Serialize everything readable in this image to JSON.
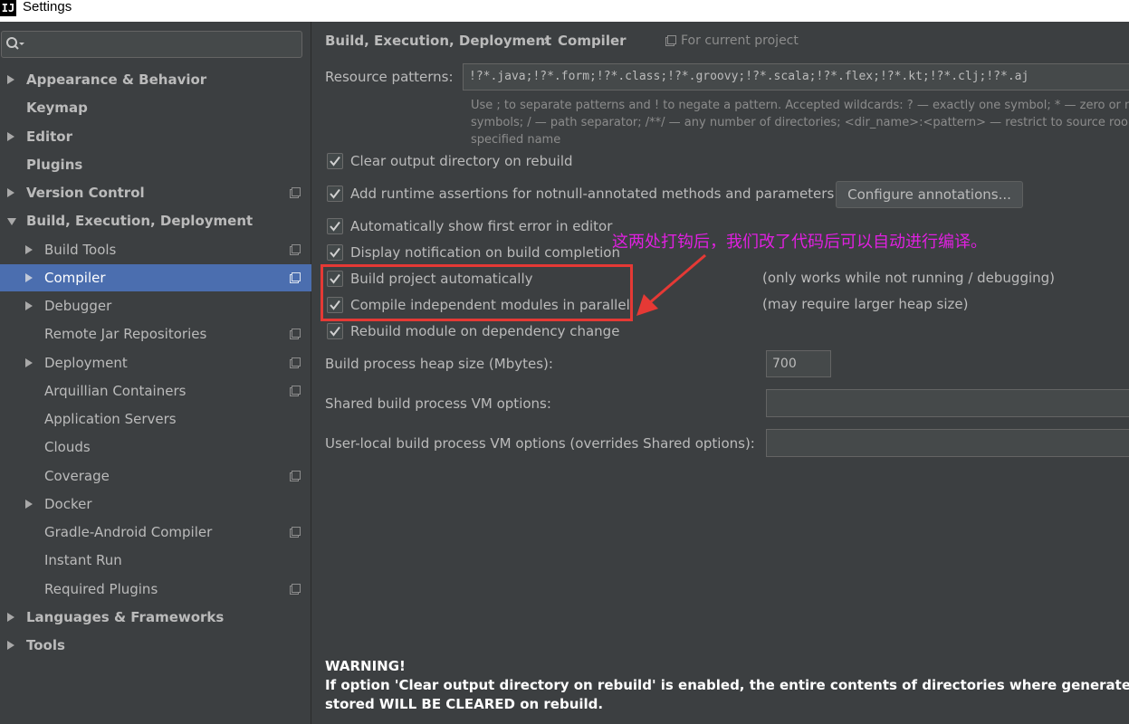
{
  "window": {
    "title": "Settings",
    "icon_glyph": "IJ"
  },
  "search": {
    "placeholder": ""
  },
  "sidebar": {
    "items": [
      {
        "label": "Appearance & Behavior",
        "level": 0,
        "arrow": "right",
        "bold": true,
        "project_icon": false,
        "selected": false
      },
      {
        "label": "Keymap",
        "level": 0,
        "arrow": "none",
        "bold": true,
        "project_icon": false,
        "selected": false
      },
      {
        "label": "Editor",
        "level": 0,
        "arrow": "right",
        "bold": true,
        "project_icon": false,
        "selected": false
      },
      {
        "label": "Plugins",
        "level": 0,
        "arrow": "none",
        "bold": true,
        "project_icon": false,
        "selected": false
      },
      {
        "label": "Version Control",
        "level": 0,
        "arrow": "right",
        "bold": true,
        "project_icon": true,
        "selected": false
      },
      {
        "label": "Build, Execution, Deployment",
        "level": 0,
        "arrow": "down",
        "bold": true,
        "project_icon": false,
        "selected": false
      },
      {
        "label": "Build Tools",
        "level": 1,
        "arrow": "right",
        "bold": false,
        "project_icon": true,
        "selected": false
      },
      {
        "label": "Compiler",
        "level": 1,
        "arrow": "right",
        "bold": false,
        "project_icon": true,
        "selected": true
      },
      {
        "label": "Debugger",
        "level": 1,
        "arrow": "right",
        "bold": false,
        "project_icon": false,
        "selected": false
      },
      {
        "label": "Remote Jar Repositories",
        "level": 1,
        "arrow": "none",
        "bold": false,
        "project_icon": true,
        "selected": false
      },
      {
        "label": "Deployment",
        "level": 1,
        "arrow": "right",
        "bold": false,
        "project_icon": true,
        "selected": false
      },
      {
        "label": "Arquillian Containers",
        "level": 1,
        "arrow": "none",
        "bold": false,
        "project_icon": true,
        "selected": false
      },
      {
        "label": "Application Servers",
        "level": 1,
        "arrow": "none",
        "bold": false,
        "project_icon": false,
        "selected": false
      },
      {
        "label": "Clouds",
        "level": 1,
        "arrow": "none",
        "bold": false,
        "project_icon": false,
        "selected": false
      },
      {
        "label": "Coverage",
        "level": 1,
        "arrow": "none",
        "bold": false,
        "project_icon": true,
        "selected": false
      },
      {
        "label": "Docker",
        "level": 1,
        "arrow": "right",
        "bold": false,
        "project_icon": false,
        "selected": false
      },
      {
        "label": "Gradle-Android Compiler",
        "level": 1,
        "arrow": "none",
        "bold": false,
        "project_icon": true,
        "selected": false
      },
      {
        "label": "Instant Run",
        "level": 1,
        "arrow": "none",
        "bold": false,
        "project_icon": false,
        "selected": false
      },
      {
        "label": "Required Plugins",
        "level": 1,
        "arrow": "none",
        "bold": false,
        "project_icon": true,
        "selected": false
      },
      {
        "label": "Languages & Frameworks",
        "level": 0,
        "arrow": "right",
        "bold": true,
        "project_icon": false,
        "selected": false
      },
      {
        "label": "Tools",
        "level": 0,
        "arrow": "right",
        "bold": true,
        "project_icon": false,
        "selected": false
      }
    ]
  },
  "header": {
    "crumb_1": "Build, Execution, Deployment",
    "separator": "›",
    "crumb_2": "Compiler",
    "scope": "For current project"
  },
  "resource_patterns": {
    "label": "Resource patterns:",
    "value": "!?*.java;!?*.form;!?*.class;!?*.groovy;!?*.scala;!?*.flex;!?*.kt;!?*.clj;!?*.aj",
    "help_1": "Use ; to separate patterns and ! to negate a pattern. Accepted wildcards: ? — exactly one symbol; * — zero or m",
    "help_2": "symbols; / — path separator; /**/ — any number of directories; <dir_name>:<pattern> — restrict to source roo",
    "help_3": "specified name"
  },
  "options": {
    "clear_output": {
      "label": "Clear output directory on rebuild",
      "checked": true
    },
    "runtime_assertions": {
      "label": "Add runtime assertions for notnull-annotated methods and parameters",
      "checked": true
    },
    "show_first_error": {
      "label": "Automatically show first error in editor",
      "checked": true
    },
    "display_notification": {
      "label": "Display notification on build completion",
      "checked": true
    },
    "build_automatically": {
      "label": "Build project automatically",
      "checked": true,
      "note": "(only works while not running / debugging)"
    },
    "compile_parallel": {
      "label": "Compile independent modules in parallel",
      "checked": true,
      "note": "(may require larger heap size)"
    },
    "rebuild_on_dependency": {
      "label": "Rebuild module on dependency change",
      "checked": true
    }
  },
  "configure_button": "Configure annotations...",
  "heap_size": {
    "label": "Build process heap size (Mbytes):",
    "value": "700"
  },
  "shared_vm": {
    "label": "Shared build process VM options:",
    "value": ""
  },
  "user_vm": {
    "label": "User-local build process VM options (overrides Shared options):",
    "value": ""
  },
  "annotation": {
    "text": "这两处打钩后，我们改了代码后可以自动进行编译。",
    "color": "#e020e0",
    "box_color": "#e53935"
  },
  "warning": {
    "title": "WARNING!",
    "line_1": "If option 'Clear output directory on rebuild' is enabled, the entire contents of directories where generated sources a",
    "line_2": "stored WILL BE CLEARED on rebuild."
  },
  "colors": {
    "selection": "#4b6eaf",
    "background": "#3c3f41",
    "text": "#bbbbbb"
  }
}
